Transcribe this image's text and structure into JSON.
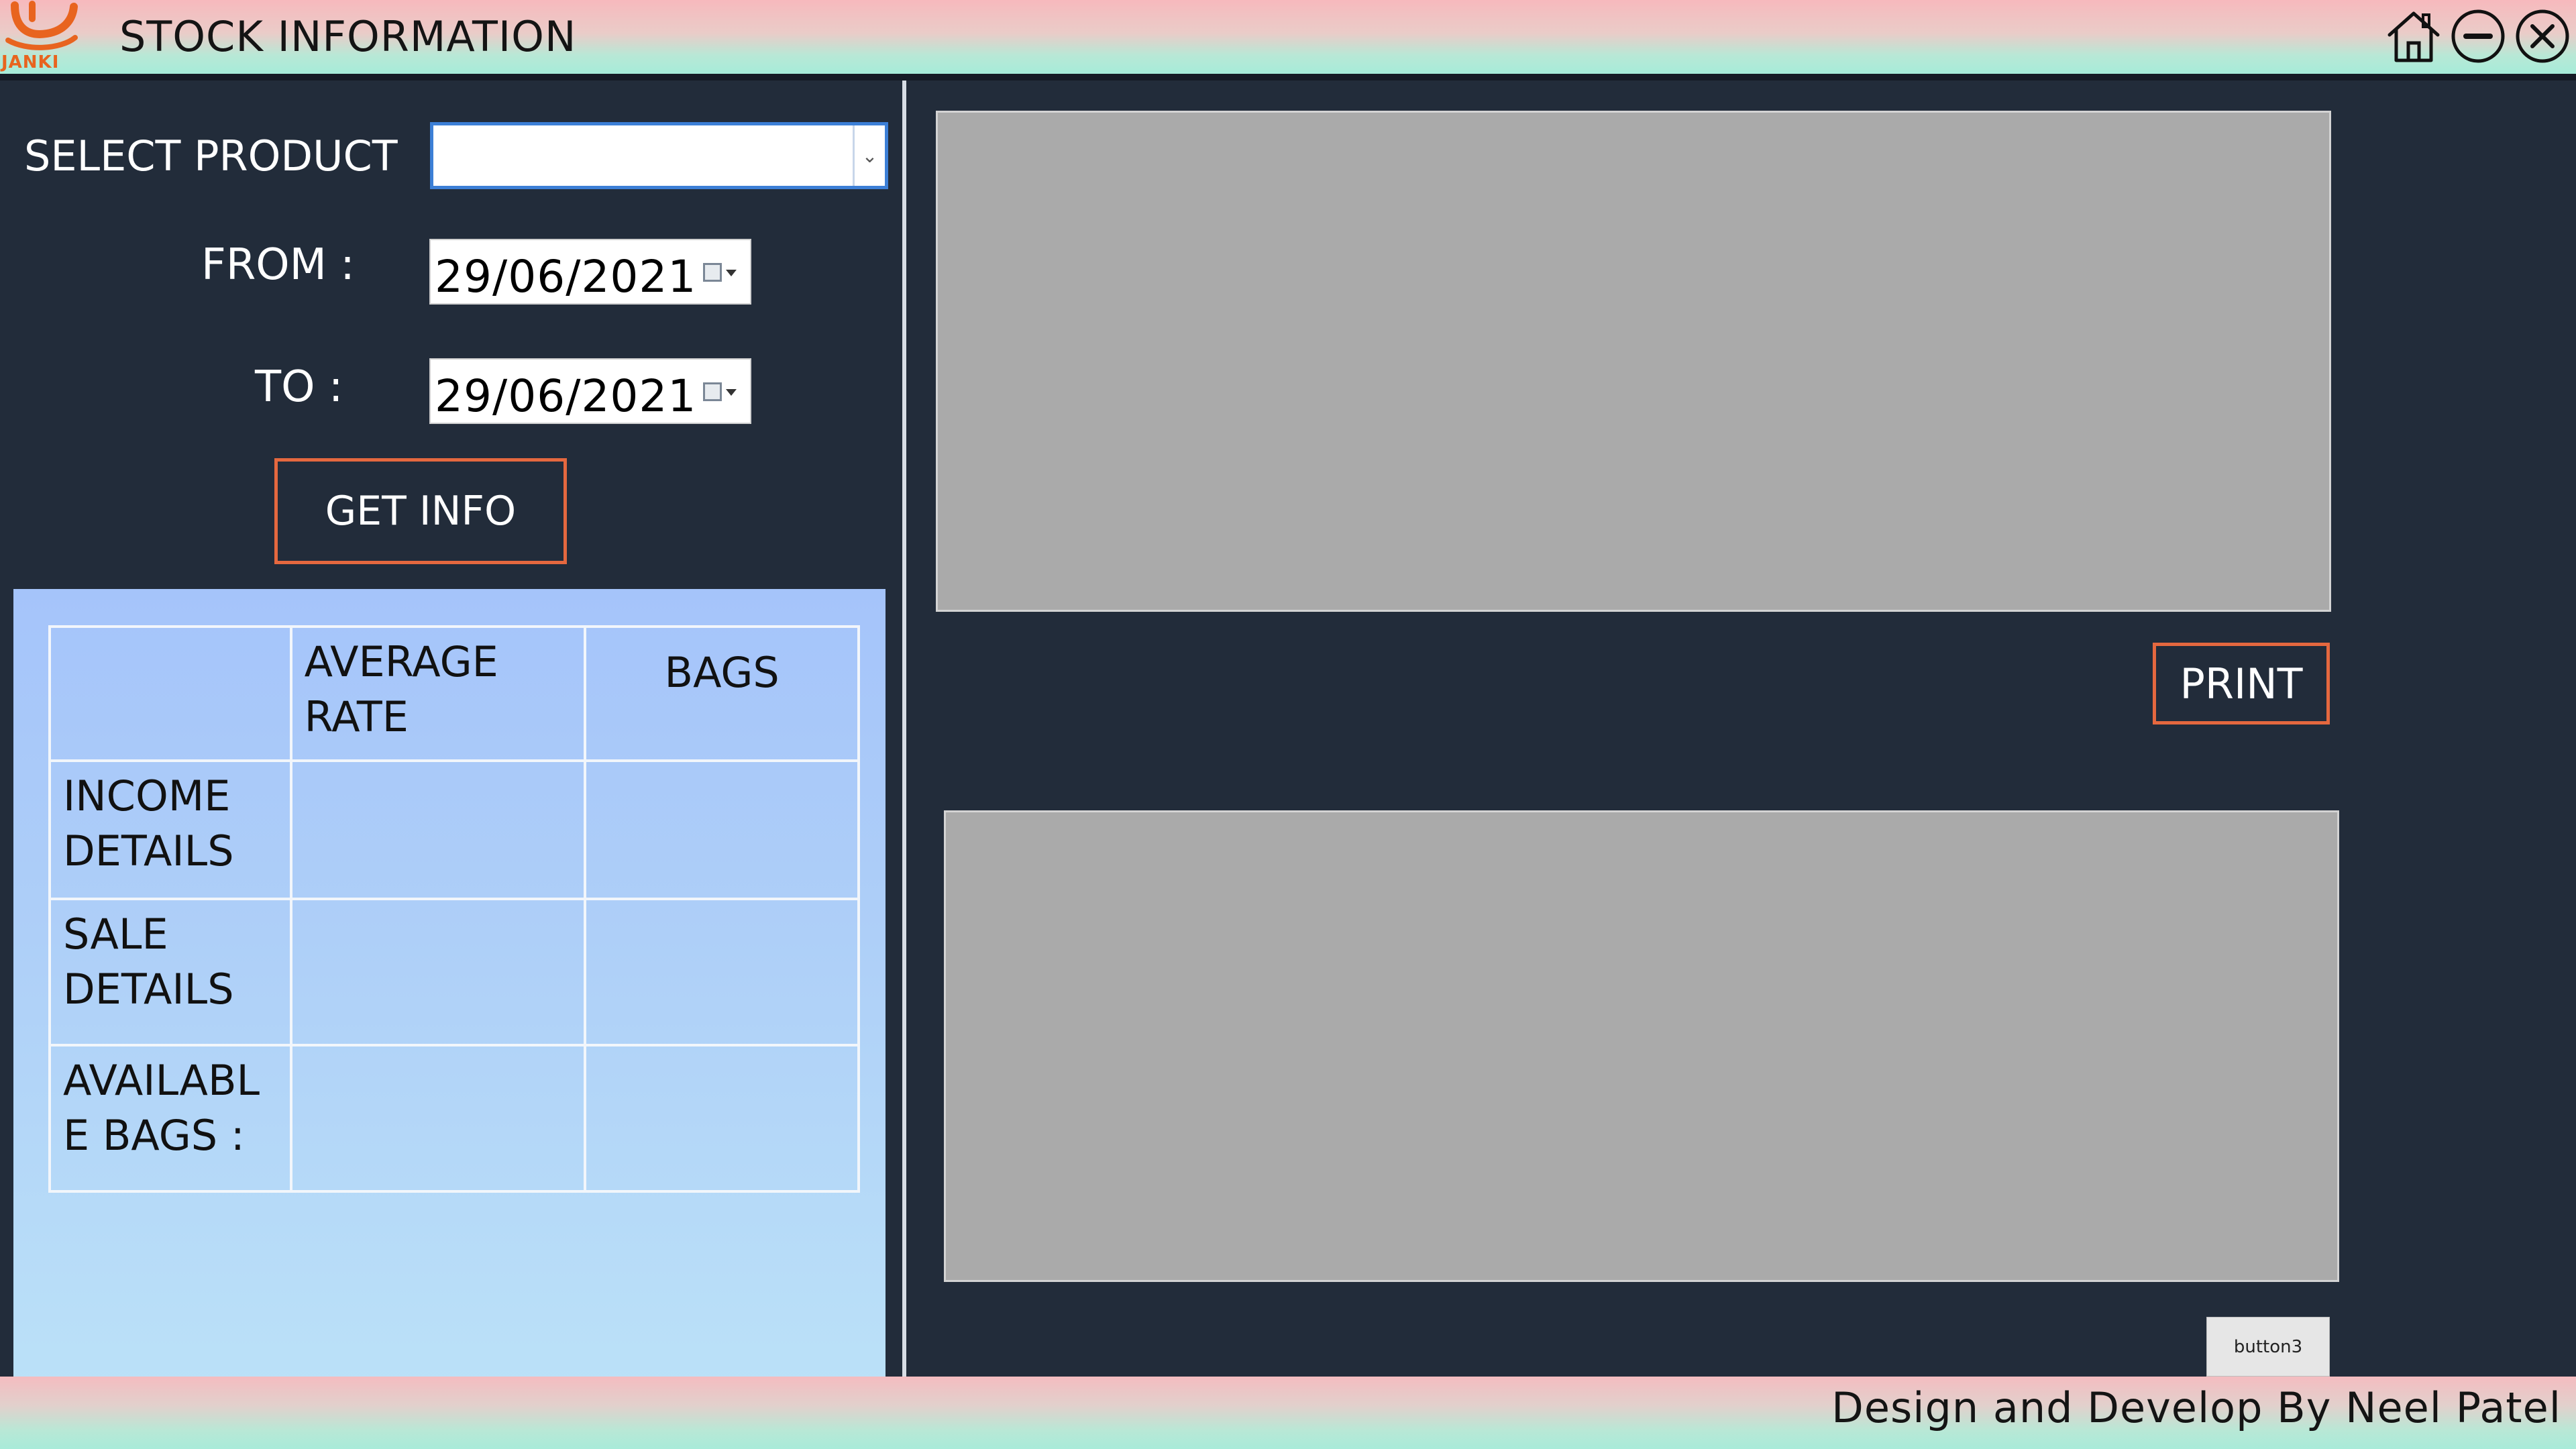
{
  "window": {
    "title": "STOCK INFORMATION",
    "logo_text": "JANKI",
    "icons": {
      "home": "home-icon",
      "minimize": "minimize-icon",
      "close": "close-icon"
    }
  },
  "form": {
    "product_label": "SELECT PRODUCT",
    "product_value": "",
    "from_label": "FROM :",
    "from_value": "29/06/2021",
    "to_label": "TO :",
    "to_value": "29/06/2021",
    "get_info_label": "GET INFO"
  },
  "summary_table": {
    "headers": [
      "",
      "AVERAGE RATE",
      "BAGS"
    ],
    "rows": [
      {
        "label": "INCOME DETAILS",
        "average_rate": "",
        "bags": ""
      },
      {
        "label": "SALE DETAILS",
        "average_rate": "",
        "bags": ""
      },
      {
        "label": "AVAILABL E BAGS :",
        "average_rate": "",
        "bags": ""
      }
    ]
  },
  "actions": {
    "print_label": "PRINT",
    "button3_label": "button3"
  },
  "footer": {
    "credit": "Design and Develop By Neel Patel"
  },
  "colors": {
    "background": "#222c3a",
    "accent_border": "#e5683f",
    "grid_panel": "#aaaaaa",
    "summary_panel_top": "#a5c4fa",
    "summary_panel_bottom": "#bde4f8",
    "logo_orange": "#e8641f"
  }
}
